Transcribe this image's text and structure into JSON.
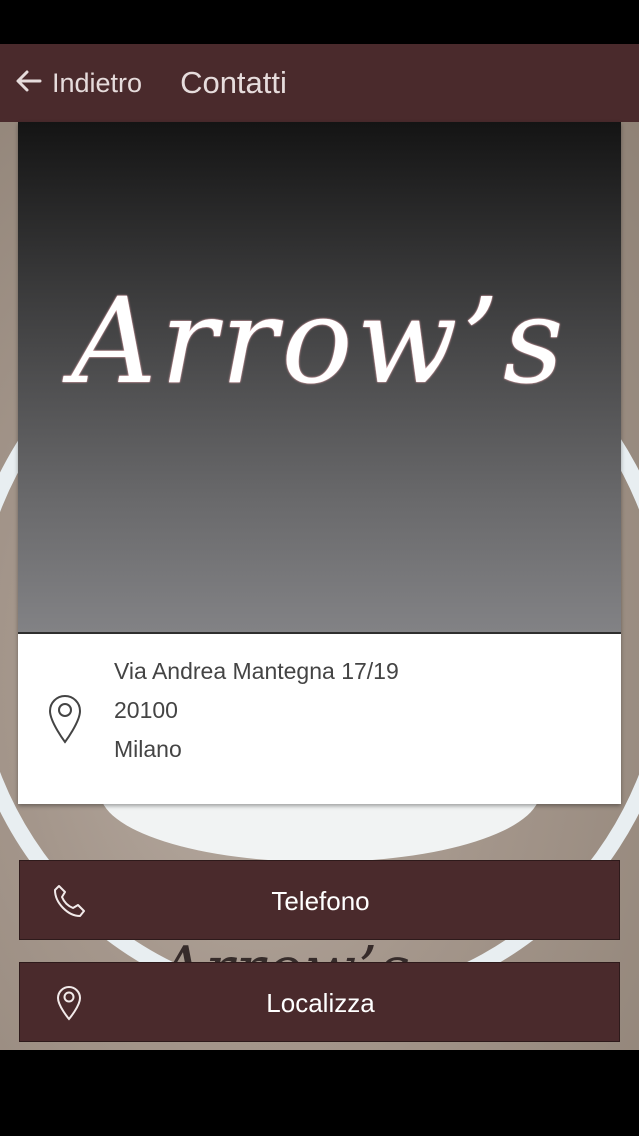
{
  "header": {
    "back_label": "Indietro",
    "title": "Contatti"
  },
  "card": {
    "logo_text": "Arrow’s",
    "address": {
      "street": "Via Andrea Mantegna 17/19",
      "zip": "20100",
      "city": "Milano"
    }
  },
  "actions": {
    "phone_label": "Telefono",
    "locate_label": "Localizza"
  },
  "colors": {
    "brand": "#4a2a2c",
    "text_light": "#e6dcdc"
  }
}
